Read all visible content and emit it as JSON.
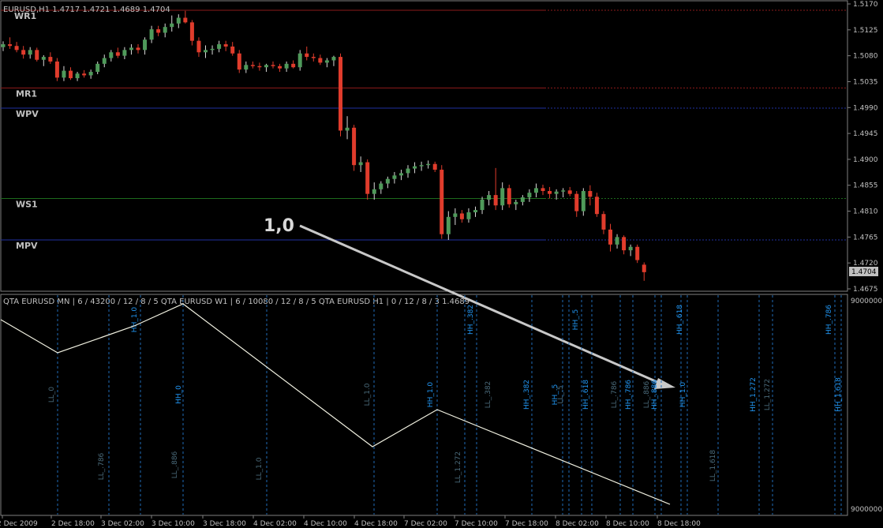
{
  "main_header": "EURUSD,H1  1.4717 1.4721 1.4689 1.4704",
  "current_price_label": "1.4704",
  "price_axis": {
    "range": [
      1.4664,
      1.5174
    ],
    "ticks": [
      "1.5170",
      "1.5125",
      "1.5080",
      "1.5035",
      "1.4990",
      "1.4945",
      "1.4900",
      "1.4855",
      "1.4810",
      "1.4765",
      "1.4720",
      "1.4675"
    ]
  },
  "pivot_levels": [
    {
      "name": "WR1",
      "price": 1.5159,
      "color": "#8b1a1a"
    },
    {
      "name": "MR1",
      "price": 1.5024,
      "color": "#8b1a1a"
    },
    {
      "name": "WPV",
      "price": 1.4989,
      "color": "#1f2fa0"
    },
    {
      "name": "WS1",
      "price": 1.4832,
      "color": "#1d6b1d"
    },
    {
      "name": "MPV",
      "price": 1.476,
      "color": "#1f2fa0"
    }
  ],
  "annotation": {
    "text": "1,0"
  },
  "sub_header": "QTA EURUSD MN | 6 / 43200 / 12 / 8 / 5  QTA EURUSD W1 | 6 / 10080 / 12 / 8 / 5  QTA EURUSD H1 | 0 / 12 / 8 / 3 1.4689",
  "sub_axis": {
    "top": "9000000",
    "bottom": "9000000"
  },
  "time_axis": [
    "2 Dec 2009",
    "2 Dec 18:00",
    "3 Dec 02:00",
    "3 Dec 10:00",
    "3 Dec 18:00",
    "4 Dec 02:00",
    "4 Dec 10:00",
    "4 Dec 18:00",
    "7 Dec 02:00",
    "7 Dec 10:00",
    "7 Dec 18:00",
    "8 Dec 02:00",
    "8 Dec 10:00",
    "8 Dec 18:00"
  ],
  "fib_labels": [
    {
      "text": "LL_0",
      "color": "#4a6a7a"
    },
    {
      "text": "LL_.786",
      "color": "#4a6a7a"
    },
    {
      "text": "HH_1.0",
      "color": "#2196f3"
    },
    {
      "text": "LL_.886",
      "color": "#4a6a7a"
    },
    {
      "text": "HH_0",
      "color": "#2196f3"
    },
    {
      "text": "LL_1.0",
      "color": "#4a6a7a"
    },
    {
      "text": "LL_1.0",
      "color": "#4a6a7a"
    },
    {
      "text": "HH_1.0",
      "color": "#2196f3"
    },
    {
      "text": "LL_1.272",
      "color": "#4a6a7a"
    },
    {
      "text": "HH_.382",
      "color": "#2196f3"
    },
    {
      "text": "LL_.382",
      "color": "#4a6a7a"
    },
    {
      "text": "HH_.382",
      "color": "#2196f3"
    },
    {
      "text": "HH_.5",
      "color": "#2196f3"
    },
    {
      "text": "LL_.5",
      "color": "#4a6a7a"
    },
    {
      "text": "HH_.5",
      "color": "#2196f3"
    },
    {
      "text": "HH_.618",
      "color": "#2196f3"
    },
    {
      "text": "LL_.786",
      "color": "#4a6a7a"
    },
    {
      "text": "HH_.786",
      "color": "#2196f3"
    },
    {
      "text": "LL_.886",
      "color": "#4a6a7a"
    },
    {
      "text": "HH_.886",
      "color": "#2196f3"
    },
    {
      "text": "HH_1.0",
      "color": "#2196f3"
    },
    {
      "text": "HH_.618",
      "color": "#2196f3"
    },
    {
      "text": "LL_1.618",
      "color": "#4a6a7a"
    },
    {
      "text": "HH_1.272",
      "color": "#2196f3"
    },
    {
      "text": "LL_1.272",
      "color": "#4a6a7a"
    },
    {
      "text": "HH_.786",
      "color": "#2196f3"
    },
    {
      "text": "HH_1.618",
      "color": "#2196f3"
    }
  ],
  "candles": [
    [
      1.5095,
      1.5105,
      1.5088,
      1.51
    ],
    [
      1.51,
      1.5112,
      1.5092,
      1.5097
    ],
    [
      1.5097,
      1.5104,
      1.5086,
      1.509
    ],
    [
      1.509,
      1.5097,
      1.5075,
      1.5082
    ],
    [
      1.5082,
      1.5095,
      1.5075,
      1.509
    ],
    [
      1.509,
      1.5094,
      1.507,
      1.5073
    ],
    [
      1.5073,
      1.5081,
      1.5062,
      1.5078
    ],
    [
      1.5078,
      1.5086,
      1.5066,
      1.507
    ],
    [
      1.507,
      1.5076,
      1.5036,
      1.5042
    ],
    [
      1.5042,
      1.5062,
      1.5036,
      1.5054
    ],
    [
      1.5054,
      1.506,
      1.5038,
      1.5041
    ],
    [
      1.5041,
      1.5052,
      1.5036,
      1.5049
    ],
    [
      1.5049,
      1.5055,
      1.5042,
      1.5046
    ],
    [
      1.5046,
      1.5056,
      1.504,
      1.5052
    ],
    [
      1.5052,
      1.507,
      1.5048,
      1.5066
    ],
    [
      1.5066,
      1.5082,
      1.506,
      1.5076
    ],
    [
      1.5076,
      1.509,
      1.507,
      1.5086
    ],
    [
      1.5086,
      1.5094,
      1.5076,
      1.508
    ],
    [
      1.508,
      1.5095,
      1.5074,
      1.509
    ],
    [
      1.509,
      1.51,
      1.5082,
      1.5094
    ],
    [
      1.5094,
      1.51,
      1.5084,
      1.509
    ],
    [
      1.509,
      1.5112,
      1.5082,
      1.5108
    ],
    [
      1.5108,
      1.5132,
      1.5102,
      1.5126
    ],
    [
      1.5126,
      1.5132,
      1.5114,
      1.512
    ],
    [
      1.512,
      1.5136,
      1.5112,
      1.513
    ],
    [
      1.513,
      1.515,
      1.5122,
      1.5136
    ],
    [
      1.5136,
      1.5152,
      1.5128,
      1.5146
    ],
    [
      1.5146,
      1.5158,
      1.5136,
      1.5138
    ],
    [
      1.5138,
      1.5142,
      1.5098,
      1.5106
    ],
    [
      1.5106,
      1.5112,
      1.5078,
      1.5086
    ],
    [
      1.5086,
      1.5098,
      1.5076,
      1.509
    ],
    [
      1.509,
      1.5098,
      1.5082,
      1.5092
    ],
    [
      1.5092,
      1.5106,
      1.5086,
      1.51
    ],
    [
      1.51,
      1.5106,
      1.5088,
      1.5096
    ],
    [
      1.5096,
      1.5104,
      1.508,
      1.5084
    ],
    [
      1.5084,
      1.509,
      1.505,
      1.5056
    ],
    [
      1.5056,
      1.507,
      1.505,
      1.5064
    ],
    [
      1.5064,
      1.507,
      1.5058,
      1.5062
    ],
    [
      1.5062,
      1.5068,
      1.5054,
      1.506
    ],
    [
      1.506,
      1.5066,
      1.5052,
      1.5064
    ],
    [
      1.5064,
      1.507,
      1.5058,
      1.5062
    ],
    [
      1.5062,
      1.5066,
      1.5052,
      1.5058
    ],
    [
      1.5058,
      1.507,
      1.5052,
      1.5066
    ],
    [
      1.5066,
      1.5072,
      1.5058,
      1.506
    ],
    [
      1.506,
      1.509,
      1.5054,
      1.5084
    ],
    [
      1.5084,
      1.5096,
      1.5072,
      1.5078
    ],
    [
      1.5078,
      1.5084,
      1.507,
      1.5076
    ],
    [
      1.5076,
      1.5082,
      1.5064,
      1.5068
    ],
    [
      1.5068,
      1.5076,
      1.506,
      1.5072
    ],
    [
      1.5072,
      1.508,
      1.5062,
      1.5078
    ],
    [
      1.5078,
      1.5084,
      1.494,
      1.495
    ],
    [
      1.495,
      1.4975,
      1.4935,
      1.4955
    ],
    [
      1.4955,
      1.496,
      1.488,
      1.489
    ],
    [
      1.489,
      1.4905,
      1.4878,
      1.4895
    ],
    [
      1.4895,
      1.49,
      1.483,
      1.484
    ],
    [
      1.484,
      1.486,
      1.483,
      1.4848
    ],
    [
      1.4848,
      1.4862,
      1.484,
      1.4858
    ],
    [
      1.4858,
      1.487,
      1.485,
      1.4866
    ],
    [
      1.4866,
      1.4878,
      1.4858,
      1.4872
    ],
    [
      1.4872,
      1.4882,
      1.4864,
      1.4876
    ],
    [
      1.4876,
      1.489,
      1.4868,
      1.4884
    ],
    [
      1.4884,
      1.4895,
      1.4876,
      1.4888
    ],
    [
      1.4888,
      1.4896,
      1.488,
      1.489
    ],
    [
      1.489,
      1.4898,
      1.4884,
      1.4892
    ],
    [
      1.4892,
      1.4896,
      1.4878,
      1.4882
    ],
    [
      1.4882,
      1.489,
      1.4762,
      1.477
    ],
    [
      1.477,
      1.481,
      1.476,
      1.48
    ],
    [
      1.48,
      1.4815,
      1.4786,
      1.4806
    ],
    [
      1.4806,
      1.4812,
      1.479,
      1.4796
    ],
    [
      1.4796,
      1.4815,
      1.479,
      1.4808
    ],
    [
      1.4808,
      1.4818,
      1.48,
      1.4812
    ],
    [
      1.4812,
      1.4835,
      1.4805,
      1.483
    ],
    [
      1.483,
      1.4845,
      1.482,
      1.4838
    ],
    [
      1.4838,
      1.4885,
      1.4812,
      1.482
    ],
    [
      1.482,
      1.486,
      1.4812,
      1.485
    ],
    [
      1.485,
      1.4856,
      1.4816,
      1.4822
    ],
    [
      1.4822,
      1.483,
      1.4812,
      1.4826
    ],
    [
      1.4826,
      1.4838,
      1.482,
      1.4834
    ],
    [
      1.4834,
      1.4848,
      1.4826,
      1.4842
    ],
    [
      1.4842,
      1.4858,
      1.4834,
      1.485
    ],
    [
      1.485,
      1.4856,
      1.4838,
      1.4845
    ],
    [
      1.4845,
      1.4852,
      1.4832,
      1.484
    ],
    [
      1.484,
      1.4848,
      1.483,
      1.4844
    ],
    [
      1.4844,
      1.485,
      1.4834,
      1.4846
    ],
    [
      1.4846,
      1.4852,
      1.4836,
      1.484
    ],
    [
      1.484,
      1.4845,
      1.48,
      1.481
    ],
    [
      1.481,
      1.485,
      1.4802,
      1.4845
    ],
    [
      1.4845,
      1.4855,
      1.482,
      1.4835
    ],
    [
      1.4835,
      1.4842,
      1.48,
      1.4805
    ],
    [
      1.4805,
      1.481,
      1.477,
      1.4778
    ],
    [
      1.4778,
      1.4788,
      1.474,
      1.4752
    ],
    [
      1.4752,
      1.477,
      1.4745,
      1.4765
    ],
    [
      1.4765,
      1.4768,
      1.4735,
      1.4742
    ],
    [
      1.4742,
      1.4752,
      1.4732,
      1.4748
    ],
    [
      1.4748,
      1.4752,
      1.472,
      1.4725
    ],
    [
      1.4717,
      1.4721,
      1.4689,
      1.4704
    ]
  ]
}
